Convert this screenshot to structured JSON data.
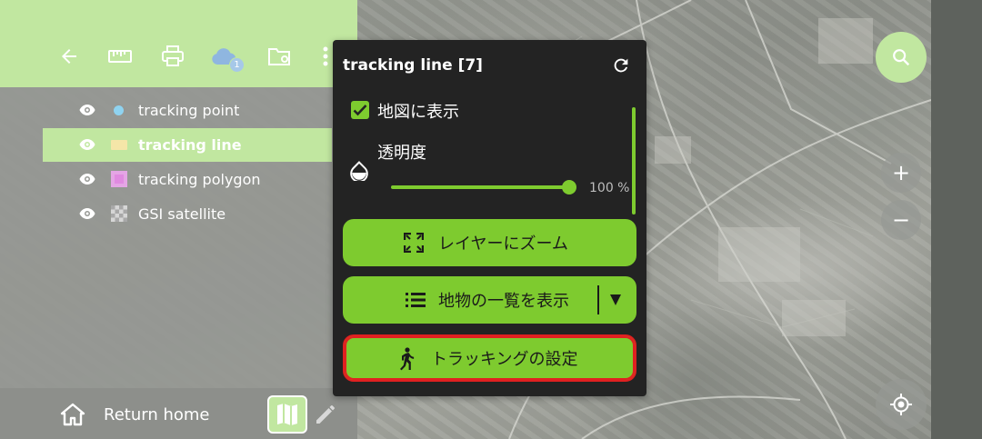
{
  "colors": {
    "accent": "#7ecb2f",
    "toolbar_bg": "#c1e7a0",
    "popup_bg": "#232323",
    "highlight_border": "#e02020",
    "panel_bg": "#969894"
  },
  "toolbar": {
    "icons": [
      "back-arrow-icon",
      "ruler-icon",
      "print-icon",
      "cloud-icon",
      "folder-settings-icon",
      "more-icon"
    ],
    "cloud_badge": "1"
  },
  "layers": [
    {
      "name": "tracking point",
      "swatch": "#8fd3f0",
      "swatch_shape": "circle",
      "visible": true,
      "selected": false
    },
    {
      "name": "tracking line",
      "swatch": "#f5e6a8",
      "swatch_shape": "line",
      "visible": true,
      "selected": true
    },
    {
      "name": "tracking polygon",
      "swatch": "#e08ae0",
      "swatch_shape": "square",
      "visible": true,
      "selected": false
    },
    {
      "name": "GSI satellite",
      "swatch": "#bdbdbd",
      "swatch_shape": "checker",
      "visible": true,
      "selected": false
    }
  ],
  "bottom": {
    "home_label": "Return home"
  },
  "popup": {
    "title": "tracking line [7]",
    "show_on_map_label": "地図に表示",
    "show_on_map_checked": true,
    "opacity_label": "透明度",
    "opacity_value_text": "100 %",
    "opacity_percent": 100,
    "zoom_to_layer_label": "レイヤーにズーム",
    "feature_list_label": "地物の一覧を表示",
    "tracking_settings_label": "トラッキングの設定"
  },
  "map_controls": {
    "zoom_in_glyph": "+",
    "zoom_out_glyph": "−"
  }
}
